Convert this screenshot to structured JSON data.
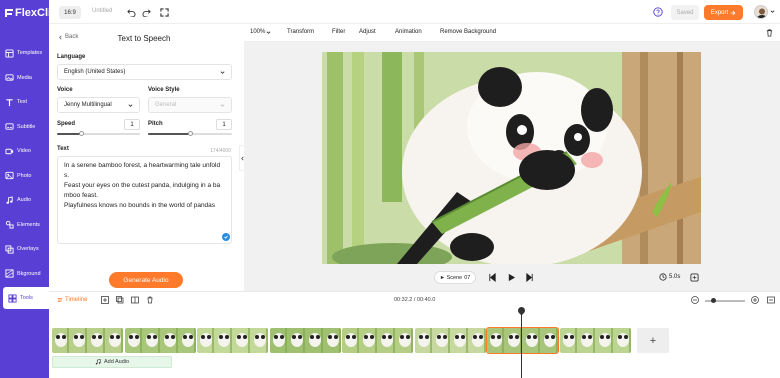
{
  "app": {
    "logo": "FlexClip"
  },
  "topbar": {
    "ratio": "16:9",
    "project_name": "Untitled",
    "saved_label": "Saved",
    "export_label": "Export"
  },
  "sidenav": {
    "items": [
      {
        "label": "Templates",
        "icon": "templates-icon"
      },
      {
        "label": "Media",
        "icon": "media-icon"
      },
      {
        "label": "Text",
        "icon": "text-icon"
      },
      {
        "label": "Subtitle",
        "icon": "subtitle-icon"
      },
      {
        "label": "Video",
        "icon": "video-icon"
      },
      {
        "label": "Photo",
        "icon": "photo-icon"
      },
      {
        "label": "Audio",
        "icon": "audio-icon"
      },
      {
        "label": "Elements",
        "icon": "elements-icon"
      },
      {
        "label": "Overlays",
        "icon": "overlays-icon"
      },
      {
        "label": "Bkground",
        "icon": "background-icon"
      },
      {
        "label": "Tools",
        "icon": "tools-icon",
        "active": true
      }
    ]
  },
  "panel": {
    "back_label": "Back",
    "title": "Text to Speech",
    "language_label": "Language",
    "language_value": "English (United States)",
    "voice_label": "Voice",
    "voice_value": "Jenny Multilingual",
    "voice_style_label": "Voice Style",
    "voice_style_value": "General",
    "speed_label": "Speed",
    "speed_value": "1",
    "speed_level": 0.3,
    "pitch_label": "Pitch",
    "pitch_value": "1",
    "pitch_level": 0.5,
    "text_label": "Text",
    "char_count": "174/4000",
    "text_value": "In a serene bamboo forest, a heartwarming tale unfold\ns.\nFeast your eyes on the cutest panda, indulging in a ba\nmboo feast.\nPlayfulness knows no bounds in the world of pandas",
    "generate_label": "Generate Audio"
  },
  "canvas_toolbar": {
    "zoom": "100%",
    "transform": "Transform",
    "filter": "Filter",
    "adjust": "Adjust",
    "animation": "Animation",
    "remove_bg": "Remove Background"
  },
  "player": {
    "scene_label": "Scene",
    "scene_number": "07",
    "duration": "5.0s"
  },
  "timeline": {
    "toggle_label": "Timeline",
    "time": "00:32.2 / 00:40.0",
    "add_audio_label": "Add Audio",
    "add_clip": "+",
    "zoom_level": 0.15
  },
  "colors": {
    "brand": "#5a3fd4",
    "accent": "#ff7a2a"
  }
}
